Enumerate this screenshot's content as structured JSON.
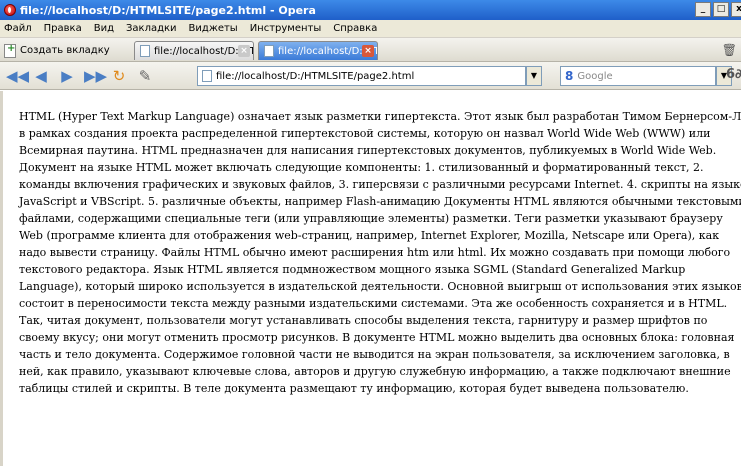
{
  "window": {
    "title": "file://localhost/D:/HTMLSITE/page2.html - Opera",
    "min_label": "_",
    "max_label": "□",
    "close_label": "x"
  },
  "menu": [
    "Файл",
    "Правка",
    "Вид",
    "Закладки",
    "Виджеты",
    "Инструменты",
    "Справка"
  ],
  "tabbar": {
    "new_tab_label": "Создать вкладку",
    "tabs": [
      {
        "title": "file://localhost/D:/HTMLS..."
      },
      {
        "title": "file://localhost/D:/HTMLS..."
      }
    ]
  },
  "navbar": {
    "address": "file://localhost/D:/HTMLSITE/page2.html",
    "search_placeholder": "Google",
    "search_logo": "8"
  },
  "content": {
    "text": "HTML (Hyper Text Markup Language) означает язык разметки гипертекста. Этот язык был разработан Тимом Бернерсом-Ли в рамках создания проекта распределенной гипертекстовой системы, которую он назвал World Wide Web (WWW) или Всемирная паутина. HTML предназначен для написания гипертекстовых документов, публикуемых в World Wide Web. Документ на языке HTML может включать следующие компоненты: 1. стилизованный и форматированный текст, 2. команды включения графических и звуковых файлов, 3. гиперсвязи с различными ресурсами Internet. 4. скрипты на языке JavaScript и VBScript. 5. различные объекты, например Flash-анимацию Документы HTML являются обычными текстовыми файлами, содержащими специальные теги (или управляющие элементы) разметки. Теги разметки указывают браузеру Web (программе клиента для отображения web-страниц, например, Internet Explorer, Mozilla, Netscape или Opera), как надо вывести страницу. Файлы HTML обычно имеют расширения htm или html. Их можно создавать при помощи любого текстового редактора. Язык HTML является подмножеством мощного языка SGML (Standard Generalized Markup Language), который широко используется в издательской деятельности. Основной выигрыш от использования этих языков состоит в переносимости текста между разными издательскими системами. Эта же особенность сохраняется и в HTML. Так, читая документ, пользователи могут устанавливать способы выделения текста, гарнитуру и размер шрифтов по своему вкусу; они могут отменить просмотр рисунков. В документе HTML можно выделить два основных блока: головная часть и тело документа. Содержимое головной части не выводится на экран пользователя, за исключением заголовка, в ней, как правило, указывают ключевые слова, авторов и другую служебную информацию, а также подключают внешние таблицы стилей и скрипты. В теле документа размещают ту информацию, которая будет выведена пользователю."
  },
  "icons": {
    "back": "◀◀",
    "prev": "◀",
    "next": "▶",
    "fast_forward": "▶▶",
    "reload": "↻",
    "edit": "✎",
    "dropdown": "▼",
    "trash": "🗑",
    "zoom": "6∂"
  },
  "colors": {
    "titlebar": "#1f5fc9",
    "active_tab": "#3a7ad8",
    "tab_close": "#d8583a"
  }
}
